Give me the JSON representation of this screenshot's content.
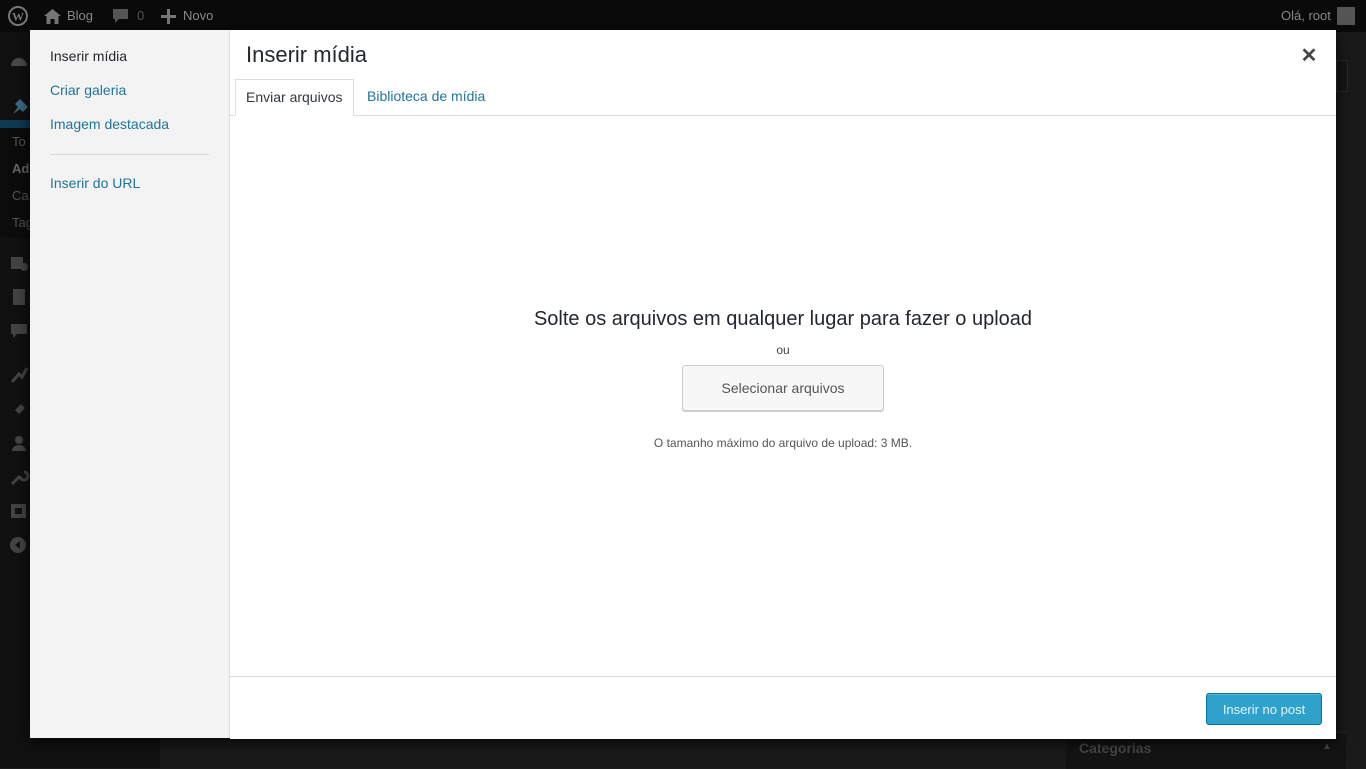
{
  "adminbar": {
    "site_name": "Blog",
    "comments_count": "0",
    "new_label": "Novo",
    "greeting": "Olá, root"
  },
  "background": {
    "sidebar_fragments": [
      "To",
      "Ad",
      "Ca",
      "Tag"
    ],
    "categories_title": "Categorias"
  },
  "modal": {
    "title": "Inserir mídia",
    "menu": {
      "items": [
        "Inserir mídia",
        "Criar galeria",
        "Imagem destacada"
      ],
      "after_separator": "Inserir do URL"
    },
    "tabs": [
      "Enviar arquivos",
      "Biblioteca de mídia"
    ],
    "active_tab": "Enviar arquivos",
    "upload": {
      "instructions": "Solte os arquivos em qualquer lugar para fazer o upload",
      "or": "ou",
      "select_button": "Selecionar arquivos",
      "max_size": "O tamanho máximo do arquivo de upload: 3 MB."
    },
    "insert_button": "Inserir no post"
  },
  "colors": {
    "link": "#21759b",
    "primary_button": "#2ea2cc",
    "adminbar": "#0a0a0a"
  }
}
